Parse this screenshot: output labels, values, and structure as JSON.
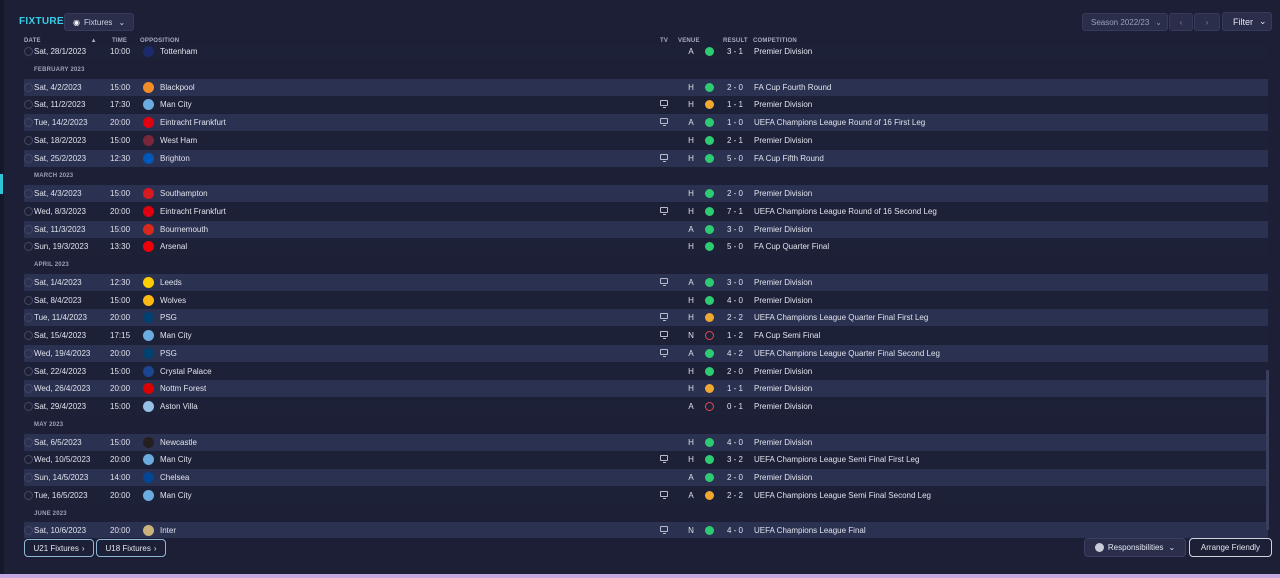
{
  "header": {
    "title": "FIXTURES",
    "view_label": "Fixtures",
    "season_label": "Season 2022/23",
    "filter_label": "Filter"
  },
  "columns": {
    "date": "DATE",
    "time": "TIME",
    "opposition": "OPPOSITION",
    "tv": "TV",
    "venue": "VENUE",
    "result": "RESULT",
    "competition": "COMPETITION"
  },
  "rows": [
    {
      "kind": "match",
      "date": "Sat, 28/1/2023",
      "time": "10:00",
      "opp": "Tottenham",
      "crest": "#1b2a6b",
      "tv": false,
      "venue": "A",
      "outcome": "w",
      "result": "3 - 1",
      "comp": "Premier Division"
    },
    {
      "kind": "month",
      "label": "FEBRUARY 2023"
    },
    {
      "kind": "match",
      "date": "Sat, 4/2/2023",
      "time": "15:00",
      "opp": "Blackpool",
      "crest": "#f28c28",
      "tv": false,
      "venue": "H",
      "outcome": "w",
      "result": "2 - 0",
      "comp": "FA Cup Fourth Round"
    },
    {
      "kind": "match",
      "date": "Sat, 11/2/2023",
      "time": "17:30",
      "opp": "Man City",
      "crest": "#6cabdd",
      "tv": true,
      "venue": "H",
      "outcome": "d",
      "result": "1 - 1",
      "comp": "Premier Division"
    },
    {
      "kind": "match",
      "date": "Tue, 14/2/2023",
      "time": "20:00",
      "opp": "Eintracht Frankfurt",
      "crest": "#e1000f",
      "tv": true,
      "venue": "A",
      "outcome": "w",
      "result": "1 - 0",
      "comp": "UEFA Champions League Round of 16  First Leg"
    },
    {
      "kind": "match",
      "date": "Sat, 18/2/2023",
      "time": "15:00",
      "opp": "West Ham",
      "crest": "#7a263a",
      "tv": false,
      "venue": "H",
      "outcome": "w",
      "result": "2 - 1",
      "comp": "Premier Division"
    },
    {
      "kind": "match",
      "date": "Sat, 25/2/2023",
      "time": "12:30",
      "opp": "Brighton",
      "crest": "#0057b8",
      "tv": true,
      "venue": "H",
      "outcome": "w",
      "result": "5 - 0",
      "comp": "FA Cup Fifth Round"
    },
    {
      "kind": "month",
      "label": "MARCH 2023"
    },
    {
      "kind": "match",
      "date": "Sat, 4/3/2023",
      "time": "15:00",
      "opp": "Southampton",
      "crest": "#d71920",
      "tv": false,
      "venue": "H",
      "outcome": "w",
      "result": "2 - 0",
      "comp": "Premier Division"
    },
    {
      "kind": "match",
      "date": "Wed, 8/3/2023",
      "time": "20:00",
      "opp": "Eintracht Frankfurt",
      "crest": "#e1000f",
      "tv": true,
      "venue": "H",
      "outcome": "w",
      "result": "7 - 1",
      "comp": "UEFA Champions League Round of 16  Second Leg"
    },
    {
      "kind": "match",
      "date": "Sat, 11/3/2023",
      "time": "15:00",
      "opp": "Bournemouth",
      "crest": "#da291c",
      "tv": false,
      "venue": "A",
      "outcome": "w",
      "result": "3 - 0",
      "comp": "Premier Division"
    },
    {
      "kind": "match",
      "date": "Sun, 19/3/2023",
      "time": "13:30",
      "opp": "Arsenal",
      "crest": "#ef0107",
      "tv": false,
      "venue": "H",
      "outcome": "w",
      "result": "5 - 0",
      "comp": "FA Cup Quarter Final"
    },
    {
      "kind": "month",
      "label": "APRIL 2023"
    },
    {
      "kind": "match",
      "date": "Sat, 1/4/2023",
      "time": "12:30",
      "opp": "Leeds",
      "crest": "#ffcd00",
      "tv": true,
      "venue": "A",
      "outcome": "w",
      "result": "3 - 0",
      "comp": "Premier Division"
    },
    {
      "kind": "match",
      "date": "Sat, 8/4/2023",
      "time": "15:00",
      "opp": "Wolves",
      "crest": "#fdb913",
      "tv": false,
      "venue": "H",
      "outcome": "w",
      "result": "4 - 0",
      "comp": "Premier Division"
    },
    {
      "kind": "match",
      "date": "Tue, 11/4/2023",
      "time": "20:00",
      "opp": "PSG",
      "crest": "#004170",
      "tv": true,
      "venue": "H",
      "outcome": "d",
      "result": "2 - 2",
      "comp": "UEFA Champions League Quarter Final First Leg"
    },
    {
      "kind": "match",
      "date": "Sat, 15/4/2023",
      "time": "17:15",
      "opp": "Man City",
      "crest": "#6cabdd",
      "tv": true,
      "venue": "N",
      "outcome": "l",
      "result": "1 - 2",
      "comp": "FA Cup Semi Final"
    },
    {
      "kind": "match",
      "date": "Wed, 19/4/2023",
      "time": "20:00",
      "opp": "PSG",
      "crest": "#004170",
      "tv": true,
      "venue": "A",
      "outcome": "w",
      "result": "4 - 2",
      "comp": "UEFA Champions League Quarter Final Second Leg"
    },
    {
      "kind": "match",
      "date": "Sat, 22/4/2023",
      "time": "15:00",
      "opp": "Crystal Palace",
      "crest": "#1b458f",
      "tv": false,
      "venue": "H",
      "outcome": "w",
      "result": "2 - 0",
      "comp": "Premier Division"
    },
    {
      "kind": "match",
      "date": "Wed, 26/4/2023",
      "time": "20:00",
      "opp": "Nottm Forest",
      "crest": "#dd0000",
      "tv": false,
      "venue": "H",
      "outcome": "d",
      "result": "1 - 1",
      "comp": "Premier Division"
    },
    {
      "kind": "match",
      "date": "Sat, 29/4/2023",
      "time": "15:00",
      "opp": "Aston Villa",
      "crest": "#95bfe5",
      "tv": false,
      "venue": "A",
      "outcome": "l",
      "result": "0 - 1",
      "comp": "Premier Division"
    },
    {
      "kind": "month",
      "label": "MAY 2023"
    },
    {
      "kind": "match",
      "date": "Sat, 6/5/2023",
      "time": "15:00",
      "opp": "Newcastle",
      "crest": "#241f20",
      "tv": false,
      "venue": "H",
      "outcome": "w",
      "result": "4 - 0",
      "comp": "Premier Division"
    },
    {
      "kind": "match",
      "date": "Wed, 10/5/2023",
      "time": "20:00",
      "opp": "Man City",
      "crest": "#6cabdd",
      "tv": true,
      "venue": "H",
      "outcome": "w",
      "result": "3 - 2",
      "comp": "UEFA Champions League Semi Final First Leg"
    },
    {
      "kind": "match",
      "date": "Sun, 14/5/2023",
      "time": "14:00",
      "opp": "Chelsea",
      "crest": "#034694",
      "tv": false,
      "venue": "A",
      "outcome": "w",
      "result": "2 - 0",
      "comp": "Premier Division"
    },
    {
      "kind": "match",
      "date": "Tue, 16/5/2023",
      "time": "20:00",
      "opp": "Man City",
      "crest": "#6cabdd",
      "tv": true,
      "venue": "A",
      "outcome": "d",
      "result": "2 - 2",
      "comp": "UEFA Champions League Semi Final Second Leg"
    },
    {
      "kind": "month",
      "label": "JUNE 2023"
    },
    {
      "kind": "match",
      "date": "Sat, 10/6/2023",
      "time": "20:00",
      "opp": "Inter",
      "crest": "#c9b27c",
      "tv": true,
      "venue": "N",
      "outcome": "w",
      "result": "4 - 0",
      "comp": "UEFA Champions League Final"
    }
  ],
  "footer": {
    "u21_label": "U21 Fixtures",
    "u18_label": "U18 Fixtures",
    "responsibilities_label": "Responsibilities",
    "arrange_label": "Arrange Friendly"
  },
  "colors": {
    "accent": "#37cde6",
    "win": "#2ecc71",
    "draw": "#f0a830",
    "loss": "#e5484d"
  }
}
